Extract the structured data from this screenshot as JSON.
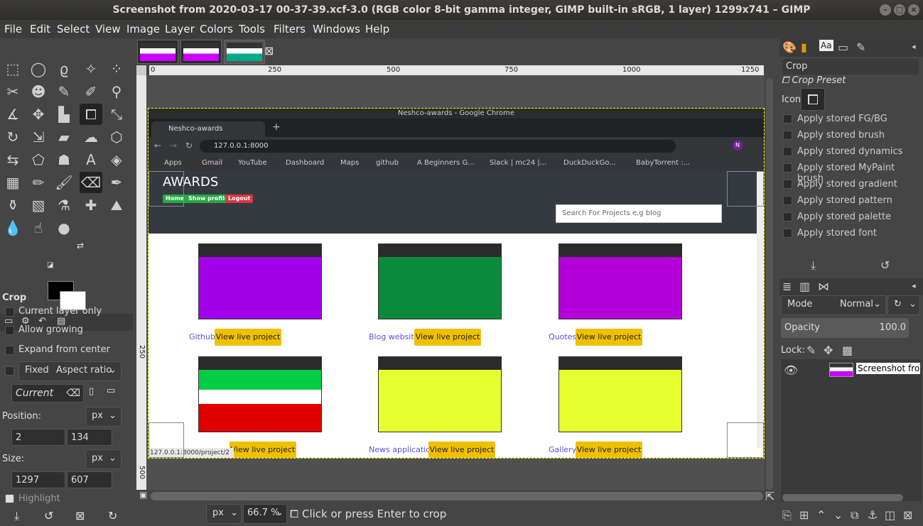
{
  "window": {
    "title": "Screenshot from 2020-03-17 00-37-39.xcf-3.0 (RGB color 8-bit gamma integer, GIMP built-in sRGB, 1 layer) 1299x741 – GIMP"
  },
  "menu": [
    "File",
    "Edit",
    "Select",
    "View",
    "Image",
    "Layer",
    "Colors",
    "Tools",
    "Filters",
    "Windows",
    "Help"
  ],
  "tool_options": {
    "title": "Crop",
    "current_layer_only": "Current layer only",
    "allow_growing": "Allow growing",
    "expand_from_center": "Expand from center",
    "fixed": "Fixed",
    "aspect_ratio": "Aspect ratio",
    "current": "Current",
    "position_label": "Position:",
    "position_unit": "px",
    "position_x": "2",
    "position_y": "134",
    "size_label": "Size:",
    "size_unit": "px",
    "size_w": "1297",
    "size_h": "607",
    "highlight": "Highlight"
  },
  "ruler": {
    "t0": "0",
    "t250": "250",
    "t500": "500",
    "t750": "750",
    "t1000": "1000",
    "t1250": "1250",
    "l250": "250",
    "l500": "500"
  },
  "statusbar": {
    "unit": "px",
    "zoom": "66.7 %",
    "message": "Click or press Enter to crop"
  },
  "browser": {
    "window_title": "Neshco-awards - Google Chrome",
    "tab": "Neshco-awards",
    "url": "127.0.0.1:8000",
    "bookmarks": [
      "Apps",
      "Gmail",
      "YouTube",
      "Dashboard",
      "Maps",
      "github",
      "A Beginners G...",
      "Slack | mc24 |...",
      "DuckDuckGo...",
      "BabyTorrent :..."
    ],
    "status_url": "127.0.0.1:8000/project/2"
  },
  "site": {
    "title": "AWARDS",
    "buttons": [
      "Home",
      "Show profile",
      "Logout"
    ],
    "search_placeholder": "Search For Projects e.g blog",
    "live_label": "View live project",
    "projects": [
      {
        "name": "Github",
        "color": "#a100e8"
      },
      {
        "name": "Blog website",
        "color": "#0a8a3a"
      },
      {
        "name": "Quotes",
        "color": "#b400d8"
      },
      {
        "name": "",
        "color": "#e00000"
      },
      {
        "name": "News application",
        "color": "#e6ff2e"
      },
      {
        "name": "Gallery",
        "color": "#e6ff2e"
      }
    ]
  },
  "right_panel": {
    "brush_filter": "Crop",
    "preset_label": "Crop Preset",
    "icon_label": "Icon:",
    "options": [
      "Apply stored FG/BG",
      "Apply stored brush",
      "Apply stored dynamics",
      "Apply stored MyPaint brush",
      "Apply stored gradient",
      "Apply stored pattern",
      "Apply stored palette",
      "Apply stored font"
    ],
    "mode_label": "Mode",
    "mode_value": "Normal",
    "opacity_label": "Opacity",
    "opacity_value": "100.0",
    "lock_label": "Lock:",
    "layer_name": "Screenshot from"
  }
}
